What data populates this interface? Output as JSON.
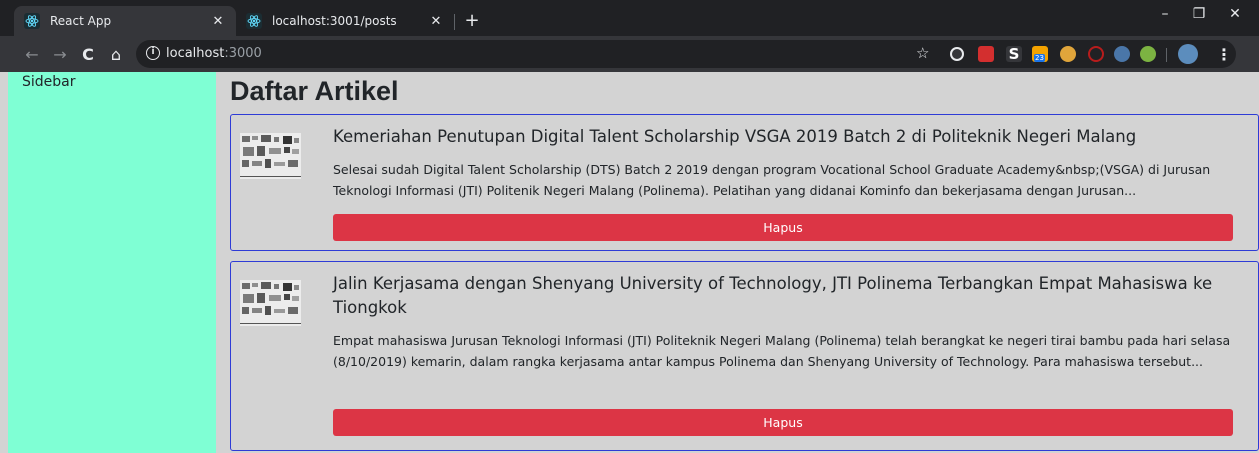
{
  "browser": {
    "tabs": [
      {
        "title": "React App",
        "active": true
      },
      {
        "title": "localhost:3001/posts",
        "active": false
      }
    ],
    "new_tab_label": "+",
    "url_host": "localhost",
    "url_port": ":3000",
    "extensions_badge": "23",
    "window_controls": {
      "minimize": "–",
      "restore": "❐",
      "close": "✕"
    }
  },
  "sidebar": {
    "label": "Sidebar"
  },
  "main": {
    "title": "Daftar Artikel",
    "articles": [
      {
        "title": "Kemeriahan Penutupan Digital Talent Scholarship VSGA 2019 Batch 2 di Politeknik Negeri Malang",
        "excerpt": "Selesai sudah Digital Talent Scholarship (DTS) Batch 2 2019 dengan program Vocational School Graduate Academy&nbsp;(VSGA) di Jurusan Teknologi Informasi (JTI) Politenik Negeri Malang (Polinema). Pelatihan yang didanai Kominfo dan bekerjasama dengan Jurusan...",
        "delete_label": "Hapus"
      },
      {
        "title": "Jalin Kerjasama dengan Shenyang University of Technology, JTI Polinema Terbangkan Empat Mahasiswa ke Tiongkok",
        "excerpt": "Empat mahasiswa Jurusan Teknologi Informasi (JTI) Politeknik Negeri Malang (Polinema) telah berangkat ke negeri tirai bambu pada hari selasa (8/10/2019) kemarin, dalam rangka kerjasama antar kampus Polinema dan Shenyang University of Technology. Para mahasiswa tersebut...",
        "delete_label": "Hapus"
      }
    ]
  },
  "colors": {
    "sidebar_bg": "#7fffd4",
    "main_bg": "#d3d3d3",
    "card_border": "#2e3bd6",
    "danger": "#dc3545"
  }
}
